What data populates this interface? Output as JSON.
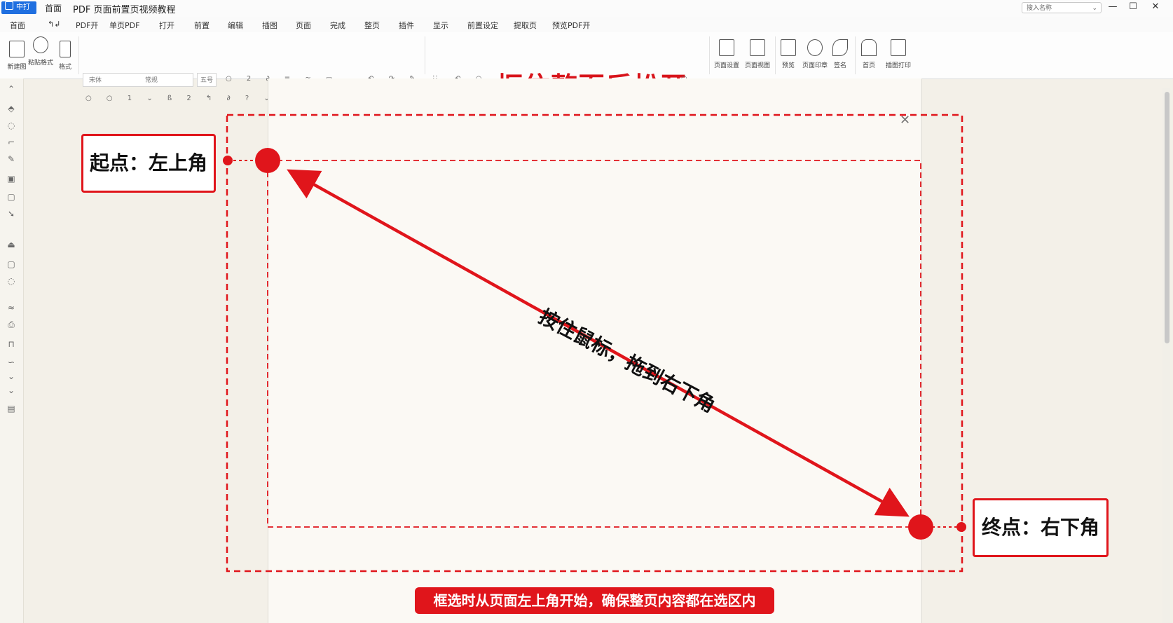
{
  "titlebar": {
    "app_badge": "中打",
    "home_tab": "首面",
    "doc_title": "PDF 页面前置页视频教程",
    "search_placeholder": "搜入名称",
    "window_controls": [
      "minimize-icon",
      "maximize-icon",
      "close-icon"
    ]
  },
  "menu": {
    "items": [
      "首面",
      "↰↲",
      "PDF开",
      "单页PDF",
      "打开",
      "前置",
      "编辑",
      "插图",
      "页面",
      "完成",
      "整页",
      "插件",
      "显示",
      "前置设定",
      "提取页",
      "预览PDF开"
    ]
  },
  "ribbon": {
    "buttons": {
      "new_doc": "新建图",
      "paste": "粘贴格式",
      "format": "格式",
      "doc_props": "页面设置",
      "page_view": "页面视图",
      "preview": "预览",
      "stamp": "页面印章",
      "sign": "签名",
      "home": "首页",
      "print": "插图打印"
    },
    "font_name": "宋体",
    "font_style": "常规",
    "font_size": "五号",
    "headline": "框住整页后松开"
  },
  "annotation": {
    "start_label": "起点：左上角",
    "end_label": "终点：右下角",
    "drag_instruction": "按住鼠标，拖到右下角",
    "tip": "框选时从页面左上角开始，确保整页内容都在选区内",
    "accent_color": "#e0151b"
  },
  "page": {
    "close_icon": "close-icon"
  }
}
